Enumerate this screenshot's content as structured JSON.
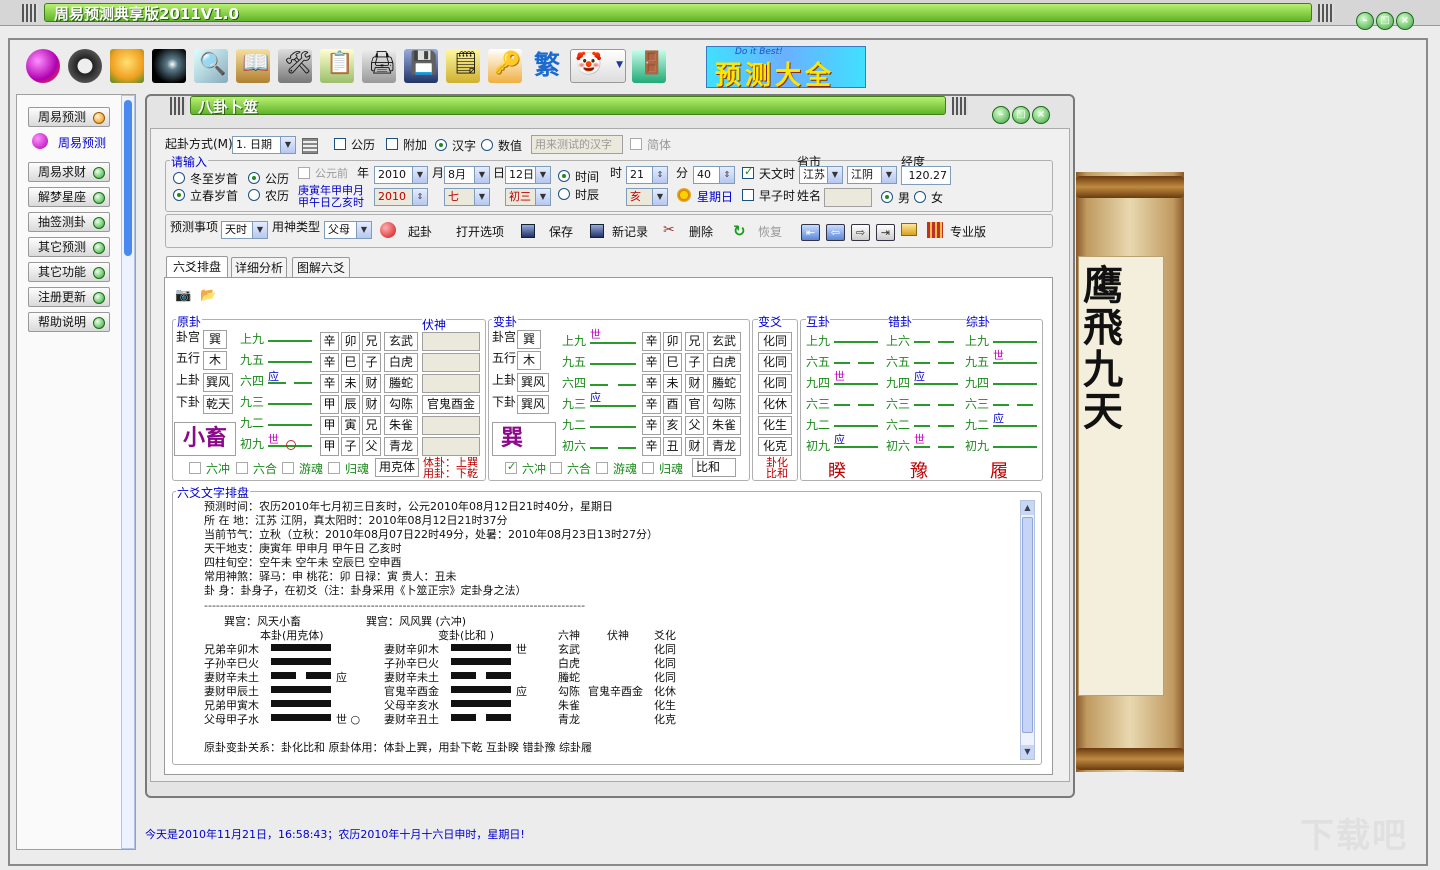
{
  "app": {
    "title": "周易预测典享版2011V1.0"
  },
  "child_window": {
    "title": "八卦卜筮"
  },
  "sidebar": {
    "items": [
      {
        "label": "周易预测"
      },
      {
        "label": "周易预测"
      },
      {
        "label": "周易求财"
      },
      {
        "label": "解梦星座"
      },
      {
        "label": "抽签测卦"
      },
      {
        "label": "其它预测"
      },
      {
        "label": "其它功能"
      },
      {
        "label": "注册更新"
      },
      {
        "label": "帮助说明"
      }
    ]
  },
  "toolbar": {
    "banner_text": "预测大全",
    "banner_sub": "Do it Best!",
    "fan_label": "繁"
  },
  "form": {
    "method_label": "起卦方式(M)",
    "method_value": "1. 日期",
    "gongli": "公历",
    "fujia": "附加",
    "hanzi": "汉字",
    "shuzhi": "数值",
    "test_placeholder": "用来测试的汉字",
    "jianti": "简体",
    "input_label": "请输入",
    "dongzhi": "冬至岁首",
    "lichun": "立春岁首",
    "cal_gong": "公历",
    "cal_nong": "农历",
    "gongyuanqian": "公元前",
    "nian": "年",
    "yue": "月",
    "ri": "日",
    "shi": "时",
    "fen": "分",
    "year": "2010",
    "month": "8月",
    "day": "12日",
    "year2": "2010",
    "month2": "七",
    "day2": "初三",
    "ganzhi1": "庚寅年甲申月",
    "ganzhi2": "甲午日乙亥时",
    "shijian": "时间",
    "shichen": "时辰",
    "hour": "21",
    "hai": "亥",
    "minute": "40",
    "xingqi": "星期日",
    "tianwen": "天文时",
    "zaozi": "早子时",
    "shengshi": "省市",
    "province": "江苏",
    "city": "江阴",
    "jingdu": "经度",
    "longitude": "120.27",
    "xingming": "姓名",
    "nan": "男",
    "nv": "女",
    "yuce_label": "预测事项",
    "yuce_value": "天时",
    "yongshen_label": "用神类型",
    "yongshen_value": "父母"
  },
  "actions": {
    "qigua": "起卦",
    "open": "打开选项",
    "save": "保存",
    "new": "新记录",
    "delete": "删除",
    "restore": "恢复",
    "pro": "专业版"
  },
  "tabs": [
    "六爻排盘",
    "详细分析",
    "图解六爻"
  ],
  "bengua": {
    "label": "原卦",
    "fushen": "伏神",
    "gong_label": "卦宫",
    "gong": "巽",
    "wuxing_label": "五行",
    "wuxing": "木",
    "upper_label": "上卦",
    "upper": "巽风",
    "lower_label": "下卦",
    "lower": "乾天",
    "name": "小畜",
    "yao": [
      {
        "n": "上九",
        "g": "辛",
        "z": "卯",
        "q": "兄",
        "s": "玄武",
        "f": "",
        "m": ""
      },
      {
        "n": "九五",
        "g": "辛",
        "z": "巳",
        "q": "子",
        "s": "白虎",
        "f": "",
        "m": ""
      },
      {
        "n": "六四",
        "g": "辛",
        "z": "未",
        "q": "财",
        "s": "螣蛇",
        "f": "",
        "m": "应"
      },
      {
        "n": "九三",
        "g": "甲",
        "z": "辰",
        "q": "财",
        "s": "勾陈",
        "f": "官鬼酉金",
        "m": ""
      },
      {
        "n": "九二",
        "g": "甲",
        "z": "寅",
        "q": "兄",
        "s": "朱雀",
        "f": "",
        "m": ""
      },
      {
        "n": "初九",
        "g": "甲",
        "z": "子",
        "q": "父",
        "s": "青龙",
        "f": "",
        "m": "世"
      }
    ],
    "liuchong": "六冲",
    "liuhe": "六合",
    "youhun": "游魂",
    "guihun": "归魂",
    "ke": "用克体",
    "tiyong1": "体卦：上巽",
    "tiyong2": "用卦：下乾"
  },
  "biangua": {
    "label": "变卦",
    "gong_label": "卦宫",
    "gong": "巽",
    "wuxing_label": "五行",
    "wuxing": "木",
    "upper_label": "上卦",
    "upper": "巽风",
    "lower_label": "下卦",
    "lower": "巽风",
    "name": "巽",
    "yao": [
      {
        "n": "上九",
        "g": "辛",
        "z": "卯",
        "q": "兄",
        "s": "玄武",
        "m": "世"
      },
      {
        "n": "九五",
        "g": "辛",
        "z": "巳",
        "q": "子",
        "s": "白虎",
        "m": ""
      },
      {
        "n": "六四",
        "g": "辛",
        "z": "未",
        "q": "财",
        "s": "螣蛇",
        "m": ""
      },
      {
        "n": "九三",
        "g": "辛",
        "z": "酉",
        "q": "官",
        "s": "勾陈",
        "m": "应"
      },
      {
        "n": "九二",
        "g": "辛",
        "z": "亥",
        "q": "父",
        "s": "朱雀",
        "m": ""
      },
      {
        "n": "初六",
        "g": "辛",
        "z": "丑",
        "q": "财",
        "s": "青龙",
        "m": ""
      }
    ],
    "liuchong": "六冲",
    "liuhe": "六合",
    "youhun": "游魂",
    "guihun": "归魂",
    "bihe": "比和"
  },
  "bianyao": {
    "label": "变爻",
    "items": [
      "化同",
      "化同",
      "化同",
      "化休",
      "化生",
      "化克"
    ],
    "footer": "卦化比和"
  },
  "hugua": {
    "label": "互卦",
    "name": "睽",
    "yao": [
      "上九",
      "六五",
      "九四",
      "六三",
      "九二",
      "初九"
    ],
    "m": [
      "",
      "",
      "世",
      "",
      "",
      "应"
    ]
  },
  "cuogua": {
    "label": "错卦",
    "name": "豫",
    "yao": [
      "上六",
      "六五",
      "九四",
      "六三",
      "六二",
      "初六"
    ],
    "m": [
      "",
      "",
      "应",
      "",
      "",
      "世"
    ]
  },
  "zonggua": {
    "label": "综卦",
    "name": "履",
    "yao": [
      "上九",
      "九五",
      "九四",
      "六三",
      "九二",
      "初九"
    ],
    "m": [
      "",
      "世",
      "",
      "",
      "应",
      ""
    ]
  },
  "text_panel": {
    "label": "六爻文字排盘",
    "lines": [
      "预测时间：农历2010年七月初三日亥时，公元2010年08月12日21时40分，星期日",
      "所 在 地：江苏 江阴，真太阳时：2010年08月12日21时37分",
      "当前节气：立秋（立秋：2010年08月07日22时49分，处暑：2010年08月23日13时27分）",
      "天干地支：庚寅年  甲申月  甲午日  乙亥时",
      "四柱旬空：空午未  空午未  空辰巳  空申酉",
      "常用神煞：驿马：申      桃花：卯      日禄：寅      贵人：丑未",
      "卦     身：卦身子，在初爻（注：卦身采用《卜筮正宗》定卦身之法）"
    ],
    "separator": "------------------------------------------------------------------------------------------------",
    "gong1": "巽宫：风天小畜",
    "gong2": "巽宫：风风巽    (六冲)",
    "col_ben": "本卦(用克体)",
    "col_bian": "变卦(比和  )",
    "col_liushen": "六神",
    "col_fushen": "伏神",
    "col_yaohua": "爻化",
    "rows": [
      {
        "b": "兄弟辛卯木",
        "bm": "",
        "v": "妻财辛卯木",
        "vm": "世",
        "l": "玄武",
        "f": "",
        "h": "化同"
      },
      {
        "b": "子孙辛巳火",
        "bm": "",
        "v": "子孙辛巳火",
        "vm": "",
        "l": "白虎",
        "f": "",
        "h": "化同"
      },
      {
        "b": "妻财辛未土",
        "bm": "应",
        "v": "妻财辛未土",
        "vm": "",
        "l": "螣蛇",
        "f": "",
        "h": "化同"
      },
      {
        "b": "妻财甲辰土",
        "bm": "",
        "v": "官鬼辛酉金",
        "vm": "应",
        "l": "勾陈",
        "f": "官鬼辛酉金",
        "h": "化休"
      },
      {
        "b": "兄弟甲寅木",
        "bm": "",
        "v": "父母辛亥水",
        "vm": "",
        "l": "朱雀",
        "f": "",
        "h": "化生"
      },
      {
        "b": "父母甲子水",
        "bm": "世  ○",
        "v": "妻财辛丑土",
        "vm": "",
        "l": "青龙",
        "f": "",
        "h": "化克"
      }
    ],
    "summary": "原卦变卦关系：卦化比和    原卦体用：体卦上巽，用卦下乾    互卦睽    错卦豫    综卦履"
  },
  "scroll_art": {
    "text": [
      "鹰",
      "飛",
      "九",
      "天"
    ]
  },
  "status": {
    "text": "今天是2010年11月21日，16:58:43；农历2010年十月十六日申时，星期日!"
  },
  "watermark": "下载吧"
}
